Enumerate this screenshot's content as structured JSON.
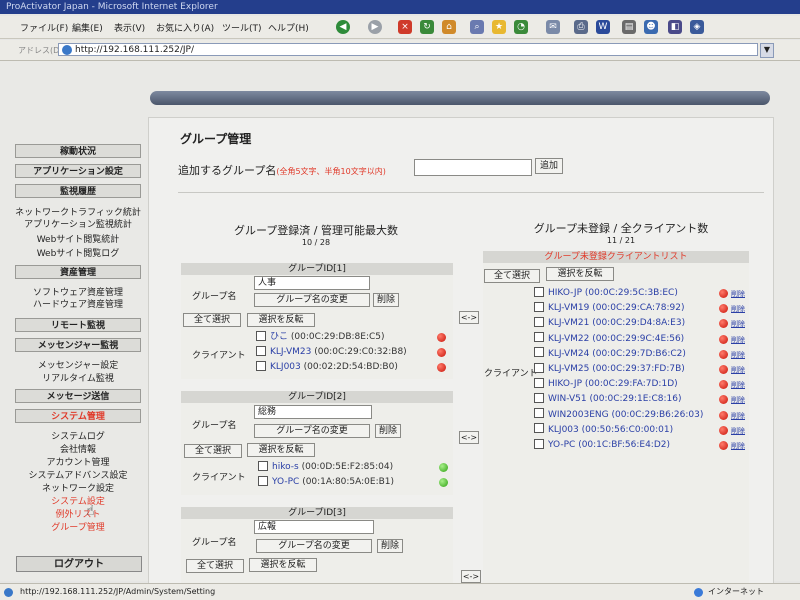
{
  "browser": {
    "title": "ProActivator Japan - Microsoft Internet Explorer",
    "menu": [
      "ファイル(F)",
      "編集(E)",
      "表示(V)",
      "お気に入り(A)",
      "ツール(T)",
      "ヘルプ(H)"
    ],
    "address_label": "アドレス(D)",
    "address": "http://192.168.111.252/JP/",
    "status_url": "http://192.168.111.252/JP/Admin/System/Setting",
    "zone": "インターネット"
  },
  "sidebar": {
    "sections": [
      {
        "label": "稼動状況",
        "active": false,
        "items": []
      },
      {
        "label": "アプリケーション設定",
        "active": false,
        "items": []
      },
      {
        "label": "監視履歴",
        "active": false,
        "items": [
          "ネットワークトラフィック統計",
          "アプリケーション監視統計",
          "Webサイト閲覧統計",
          "Webサイト閲覧ログ"
        ]
      },
      {
        "label": "資産管理",
        "active": false,
        "items": [
          "ソフトウェア資産管理",
          "ハードウェア資産管理"
        ]
      },
      {
        "label": "リモート監視",
        "active": false,
        "items": []
      },
      {
        "label": "メッセンジャー監視",
        "active": false,
        "items": [
          "メッセンジャー設定",
          "リアルタイム監視"
        ]
      },
      {
        "label": "メッセージ送信",
        "active": false,
        "items": []
      },
      {
        "label": "システム管理",
        "active": true,
        "items": [
          "システムログ",
          "会社情報",
          "アカウント管理",
          "システムアドバンス設定",
          "ネットワーク設定",
          "システム設定",
          "例外リスト",
          "グループ管理"
        ]
      }
    ],
    "logout": "ログアウト"
  },
  "main": {
    "title": "グループ管理",
    "add_label": "追加するグループ名",
    "add_note": "(全角5文字、半角10文字以内)",
    "add_button": "追加",
    "registered_title": "グループ登録済 / 管理可能最大数",
    "registered_count": "10 / 28",
    "unregistered_title": "グループ未登録 / 全クライアント数",
    "unregistered_count": "11 / 21",
    "swap_label": "<->",
    "labels": {
      "group_name": "グループ名",
      "client": "クライアント",
      "rename": "グループ名の変更",
      "delete": "削除",
      "select_all": "全て選択",
      "invert": "選択を反転",
      "del_link": "削除"
    },
    "groups": [
      {
        "header": "グループID[1]",
        "name": "人事",
        "clients": [
          {
            "name": "ひこ",
            "mac": "(00:0C:29:DB:8E:C5)",
            "status": "red"
          },
          {
            "name": "KLJ-VM23",
            "mac": "(00:0C:29:C0:32:B8)",
            "status": "red"
          },
          {
            "name": "KLJ003",
            "mac": "(00:02:2D:54:BD:B0)",
            "status": "red"
          }
        ]
      },
      {
        "header": "グループID[2]",
        "name": "総務",
        "clients": [
          {
            "name": "hiko-s",
            "mac": "(00:0D:5E:F2:85:04)",
            "status": "green"
          },
          {
            "name": "YO-PC",
            "mac": "(00:1A:80:5A:0E:B1)",
            "status": "green"
          }
        ]
      },
      {
        "header": "グループID[3]",
        "name": "広報",
        "clients": []
      }
    ],
    "unregistered": {
      "header": "グループ未登録クライアントリスト",
      "clients": [
        {
          "name": "HIKO-JP",
          "mac": "(00:0C:29:5C:3B:EC)"
        },
        {
          "name": "KLJ-VM19",
          "mac": "(00:0C:29:CA:78:92)"
        },
        {
          "name": "KLJ-VM21",
          "mac": "(00:0C:29:D4:8A:E3)"
        },
        {
          "name": "KLJ-VM22",
          "mac": "(00:0C:29:9C:4E:56)"
        },
        {
          "name": "KLJ-VM24",
          "mac": "(00:0C:29:7D:B6:C2)"
        },
        {
          "name": "KLJ-VM25",
          "mac": "(00:0C:29:37:FD:7B)"
        },
        {
          "name": "HIKO-JP",
          "mac": "(00:0C:29:FA:7D:1D)"
        },
        {
          "name": "WIN-V51",
          "mac": "(00:0C:29:1E:C8:16)"
        },
        {
          "name": "WIN2003ENG",
          "mac": "(00:0C:29:B6:26:03)"
        },
        {
          "name": "KLJ003",
          "mac": "(00:50:56:C0:00:01)"
        },
        {
          "name": "YO-PC",
          "mac": "(00:1C:BF:56:E4:D2)"
        }
      ]
    }
  },
  "colors": {
    "accent_red": "#e03a2a",
    "link_blue": "#2a3fa6",
    "status_red": "#c8140a",
    "status_green": "#2ea012"
  }
}
